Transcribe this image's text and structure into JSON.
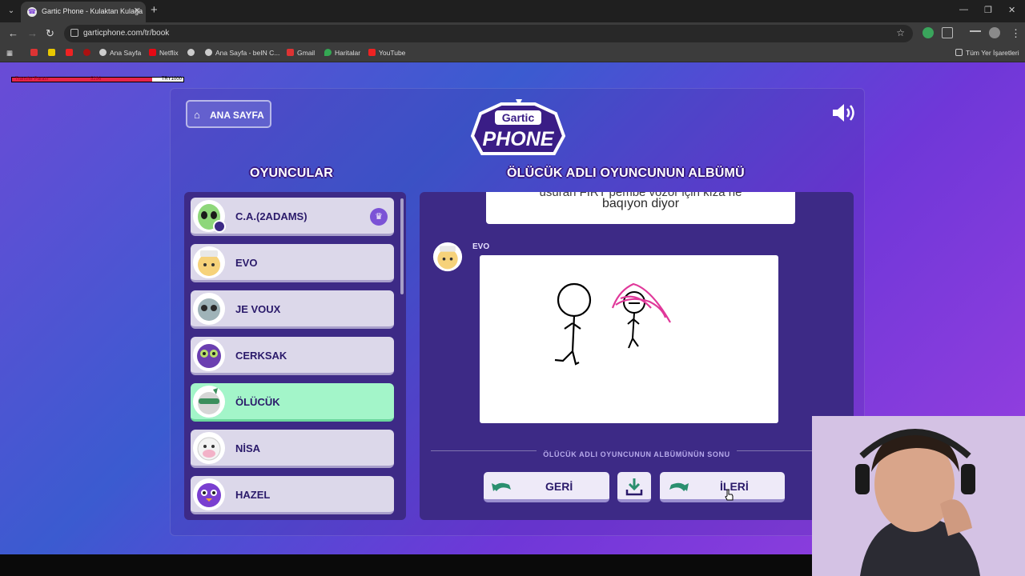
{
  "browser": {
    "tab_title": "Gartic Phone - Kulaktan Kulağa",
    "url": "garticphone.com/tr/book",
    "bookmarks": [
      "Ana Sayfa",
      "Netflix",
      "Ana Sayfa - beIN C...",
      "Gmail",
      "Haritalar",
      "YouTube"
    ],
    "all_bookmarks": "Tüm Yer İşaretleri"
  },
  "overlay": {
    "timer_left": "Transfer Parası",
    "timer_mid": "5296",
    "timer_right": "TRY1000",
    "timer_progress": 0.82
  },
  "header": {
    "home_label": "ANA SAYFA",
    "logo_top": "Gartic",
    "logo_bottom": "PHONE"
  },
  "players": {
    "title": "OYUNCULAR",
    "list": [
      {
        "name": "C.A.(2ADAMS)",
        "host": true
      },
      {
        "name": "EVO"
      },
      {
        "name": "JE VOUX"
      },
      {
        "name": "CERKSAK"
      },
      {
        "name": "ÖLÜCÜK",
        "active": true
      },
      {
        "name": "NİSA"
      },
      {
        "name": "HAZEL"
      }
    ]
  },
  "album": {
    "title": "ÖLÜCÜK ADLI OYUNCUNUN ALBÜMÜ",
    "text_card_hidden": "usuran FIRT pembe vozor için kıza ne",
    "text_card": "baqıyon diyor",
    "drawer": "EVO",
    "end_label": "ÖLÜCÜK ADLI OYUNCUNUN ALBÜMÜNÜN SONU",
    "back_label": "GERİ",
    "next_label": "İLERİ"
  },
  "colors": {
    "panel": "#3d2a86",
    "active_player": "#a3f5c9",
    "accent": "#7b52d6"
  }
}
